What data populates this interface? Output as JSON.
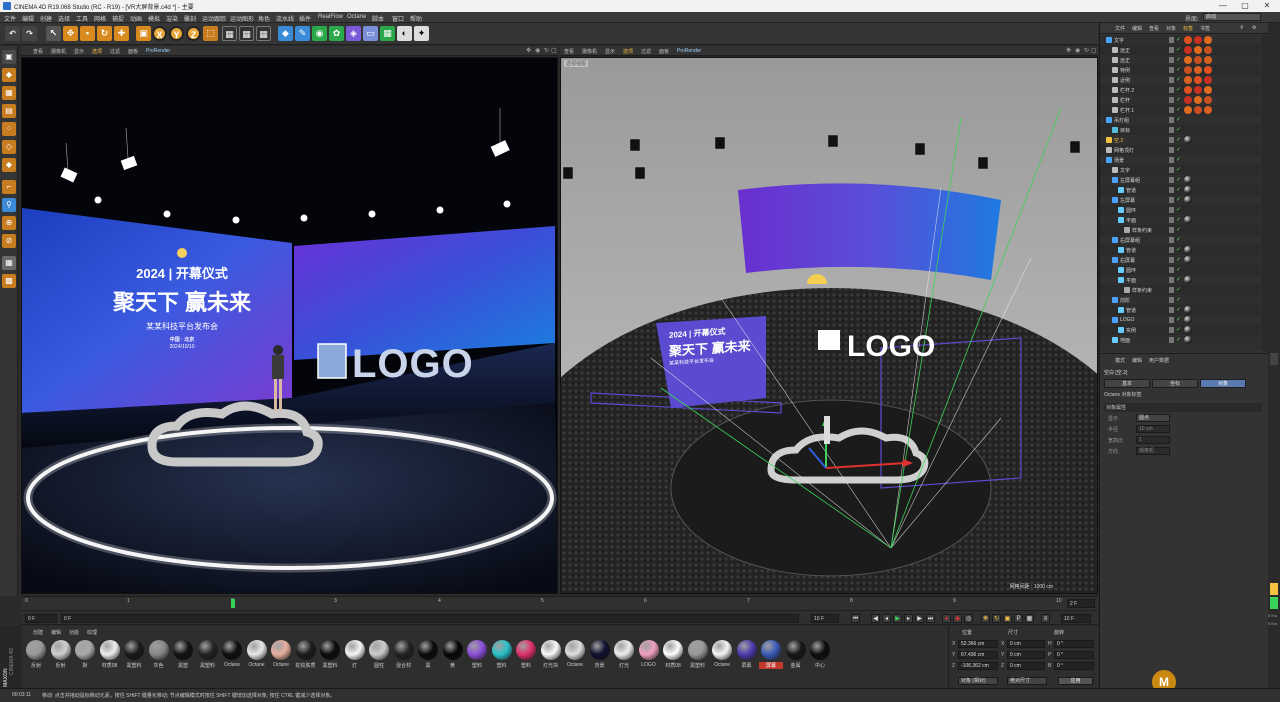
{
  "window": {
    "title": "CINEMA 4D R19.068 Studio (RC - R19) - [VR大屏背景.c4d *] - 主要",
    "min": "—",
    "max": "▢",
    "close": "✕"
  },
  "menu": [
    "文件",
    "编辑",
    "创建",
    "选择",
    "工具",
    "网格",
    "捕捉",
    "动画",
    "模拟",
    "渲染",
    "雕刻",
    "运动跟踪",
    "运动图形",
    "角色",
    "流水线",
    "插件",
    "RealFlow",
    "Octane",
    "脚本",
    "窗口",
    "帮助"
  ],
  "layout": {
    "label": "界面:",
    "value": "启动"
  },
  "toolbar": {
    "x": "X",
    "y": "Y",
    "z": "Z"
  },
  "viewport_left": {
    "menu": [
      "查看",
      "摄像机",
      "显示",
      "选项",
      "过滤",
      "面板",
      "ProRender"
    ],
    "highlight": "选项",
    "prorender": "ProRender",
    "screen": {
      "year": "2024 | 开幕仪式",
      "headline": "聚天下 赢未来",
      "sub": "某某科技平台发布会",
      "place": "中国 · 北京",
      "date": "2024/10/10"
    },
    "logo": "LOGO"
  },
  "viewport_right": {
    "menu": [
      "查看",
      "摄像机",
      "显示",
      "选项",
      "过滤",
      "面板",
      "ProRender"
    ],
    "highlight": "选项",
    "prorender": "ProRender",
    "label": "透视视图",
    "grid": "网格间距 : 1000 cm",
    "screen": {
      "year": "2024 | 开幕仪式",
      "headline": "聚天下 赢未来",
      "sub": "某某科技平台发布会"
    },
    "logo": "LOGO"
  },
  "timeline": {
    "ticks": [
      "0",
      "1",
      "2",
      "3",
      "4",
      "5",
      "6",
      "7",
      "8",
      "9",
      "10"
    ],
    "end": "2 F"
  },
  "playbar": {
    "start": "0 F",
    "cur": "0 F",
    "end": "10 F",
    "end2": "10 F"
  },
  "materials": {
    "tabs": [
      "创建",
      "编辑",
      "功能",
      "纹理"
    ],
    "items": [
      {
        "name": "反射",
        "color": "#999"
      },
      {
        "name": "反射",
        "color": "#d0d0d0"
      },
      {
        "name": "默",
        "color": "#aaa"
      },
      {
        "name": "材质08",
        "color": "#eee"
      },
      {
        "name": "黑塑料",
        "color": "#1a1a1a"
      },
      {
        "name": "灰色",
        "color": "#888"
      },
      {
        "name": "黑塑",
        "color": "#111"
      },
      {
        "name": "黑塑料",
        "color": "#222"
      },
      {
        "name": "Octane",
        "color": "#0d0d0d"
      },
      {
        "name": "Octane",
        "color": "#e8e8e8"
      },
      {
        "name": "Octane",
        "color": "#e8b0a0"
      },
      {
        "name": "蛇纹肤质",
        "color": "#1b1b1b"
      },
      {
        "name": "黑塑料",
        "color": "#0a0a0a"
      },
      {
        "name": "灯",
        "color": "#f5f5f5"
      },
      {
        "name": "圆柱",
        "color": "#ccc"
      },
      {
        "name": "混合材",
        "color": "#222"
      },
      {
        "name": "黑",
        "color": "#0a0a0a"
      },
      {
        "name": "黄",
        "color": "#050505"
      },
      {
        "name": "塑料",
        "color": "#8a4ed8"
      },
      {
        "name": "塑料",
        "color": "#2ac0c8"
      },
      {
        "name": "塑料",
        "color": "#e0306a"
      },
      {
        "name": "灯光块",
        "color": "#fafafa"
      },
      {
        "name": "Octane",
        "color": "#ddd"
      },
      {
        "name": "背景",
        "color": "#101030"
      },
      {
        "name": "灯光",
        "color": "#eee"
      },
      {
        "name": "LOGO",
        "color": "#f0a0c0"
      },
      {
        "name": "材质08",
        "color": "#fff"
      },
      {
        "name": "黑塑料",
        "color": "#999"
      },
      {
        "name": "Octane",
        "color": "#f5f5f5"
      },
      {
        "name": "屏幕",
        "color": "#4c3bb0"
      },
      {
        "name": "屏幕",
        "color": "#3a5ab8"
      },
      {
        "name": "金属",
        "color": "#161616"
      },
      {
        "name": "中心",
        "color": "#0c0c0c"
      }
    ],
    "selected_index": 30,
    "mix": "MIX"
  },
  "coords": {
    "headers": [
      "位置",
      "尺寸",
      "旋转"
    ],
    "rows": [
      {
        "axis": "X",
        "pos": "52.366 cm",
        "sizeax": "X",
        "size": "0 cm",
        "rotax": "H",
        "rot": "0 °"
      },
      {
        "axis": "Y",
        "pos": "67.436 cm",
        "sizeax": "Y",
        "size": "0 cm",
        "rotax": "P",
        "rot": "0 °"
      },
      {
        "axis": "Z",
        "pos": "-106.362 cm",
        "sizeax": "Z",
        "size": "0 cm",
        "rotax": "B",
        "rot": "0 °"
      }
    ],
    "mode1": "对象 (相对)",
    "mode2": "绝对尺寸",
    "apply": "应用"
  },
  "objects": {
    "tabs": [
      "文件",
      "编辑",
      "查看",
      "对象",
      "标签",
      "书签"
    ],
    "highlight_tab": "标签",
    "rows": [
      {
        "name": "文字",
        "indent": 0,
        "hl": false,
        "icon": "#4aa3ff"
      },
      {
        "name": "远正",
        "indent": 1,
        "hl": false,
        "icon": "#bbb"
      },
      {
        "name": "远正",
        "indent": 1,
        "hl": false,
        "icon": "#bbb"
      },
      {
        "name": "特例",
        "indent": 1,
        "hl": false,
        "icon": "#bbb"
      },
      {
        "name": "近例",
        "indent": 1,
        "hl": false,
        "icon": "#bbb"
      },
      {
        "name": "栏杆.2",
        "indent": 1,
        "hl": false,
        "icon": "#bbb"
      },
      {
        "name": "栏杆",
        "indent": 1,
        "hl": false,
        "icon": "#bbb"
      },
      {
        "name": "栏杆.1",
        "indent": 1,
        "hl": false,
        "icon": "#bbb"
      },
      {
        "name": "吊灯组",
        "indent": 0,
        "hl": false,
        "icon": "#4aa3ff"
      },
      {
        "name": "目标",
        "indent": 1,
        "hl": false,
        "icon": "#5bd"
      },
      {
        "name": "空.2",
        "indent": 0,
        "hl": true,
        "icon": "#f5c242"
      },
      {
        "name": "网格顶灯",
        "indent": 0,
        "hl": false,
        "icon": "#bbb"
      },
      {
        "name": "场景",
        "indent": 0,
        "hl": false,
        "icon": "#4aa3ff"
      },
      {
        "name": "文字",
        "indent": 1,
        "hl": false,
        "icon": "#bbb"
      },
      {
        "name": "左屏幕组",
        "indent": 1,
        "hl": false,
        "icon": "#4aa3ff"
      },
      {
        "name": "管道",
        "indent": 2,
        "hl": false,
        "icon": "#6cf"
      },
      {
        "name": "左屏幕",
        "indent": 1,
        "hl": false,
        "icon": "#4aa3ff"
      },
      {
        "name": "圆环",
        "indent": 2,
        "hl": false,
        "icon": "#6cf"
      },
      {
        "name": "平面",
        "indent": 2,
        "hl": false,
        "icon": "#6cf"
      },
      {
        "name": "样条约束",
        "indent": 3,
        "hl": false,
        "icon": "#aaa"
      },
      {
        "name": "右屏幕组",
        "indent": 1,
        "hl": false,
        "icon": "#4aa3ff"
      },
      {
        "name": "管道",
        "indent": 2,
        "hl": false,
        "icon": "#6cf"
      },
      {
        "name": "右屏幕",
        "indent": 1,
        "hl": false,
        "icon": "#4aa3ff"
      },
      {
        "name": "圆环",
        "indent": 2,
        "hl": false,
        "icon": "#6cf"
      },
      {
        "name": "平面",
        "indent": 2,
        "hl": false,
        "icon": "#6cf"
      },
      {
        "name": "样条约束",
        "indent": 3,
        "hl": false,
        "icon": "#aaa"
      },
      {
        "name": "前阶",
        "indent": 1,
        "hl": false,
        "icon": "#4aa3ff"
      },
      {
        "name": "管道",
        "indent": 2,
        "hl": false,
        "icon": "#6cf"
      },
      {
        "name": "LOGO",
        "indent": 1,
        "hl": false,
        "icon": "#4aa3ff"
      },
      {
        "name": "实例",
        "indent": 2,
        "hl": false,
        "icon": "#6cf"
      },
      {
        "name": "地面",
        "indent": 1,
        "hl": false,
        "icon": "#6cf"
      }
    ]
  },
  "attributes": {
    "tabs": [
      "模式",
      "编辑",
      "用户数据"
    ],
    "object_label": "空白 [空.2]",
    "tabs2": [
      "基本",
      "坐标",
      "对象"
    ],
    "active_tab2": "对象",
    "octane": "Octane 对象标签",
    "section": "对象属性",
    "props": [
      {
        "label": "显示",
        "value": "圆点"
      },
      {
        "label": "半径",
        "value": "10 cm"
      },
      {
        "label": "宽高比",
        "value": "1"
      },
      {
        "label": "方向",
        "value": "摄像机"
      }
    ]
  },
  "status": {
    "time": "00:03:11",
    "text": "移动: 点击并拖动鼠标移动元素。按住 SHIFT 键量化移动; 节点编辑模式时按住 SHIFT 键增加选择对象; 按住 CTRL 键减少选择对象。"
  },
  "right_strip": {
    "pct1": "0 K/s",
    "pct2": "0 K/s"
  },
  "brand": {
    "maxon": "MAXON",
    "cinema": "CINEMA 4D"
  }
}
